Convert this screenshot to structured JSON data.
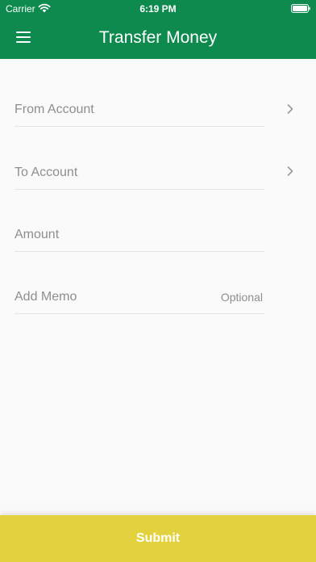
{
  "status_bar": {
    "carrier": "Carrier",
    "time": "6:19 PM"
  },
  "header": {
    "title": "Transfer Money",
    "background_color": "#0e8a4f"
  },
  "form": {
    "from_account": {
      "placeholder": "From Account",
      "icon": "chevron-right-icon"
    },
    "to_account": {
      "placeholder": "To Account",
      "icon": "chevron-right-icon"
    },
    "amount": {
      "placeholder": "Amount"
    },
    "memo": {
      "placeholder": "Add Memo",
      "hint": "Optional"
    }
  },
  "submit": {
    "label": "Submit",
    "background_color": "#e3d23e"
  }
}
